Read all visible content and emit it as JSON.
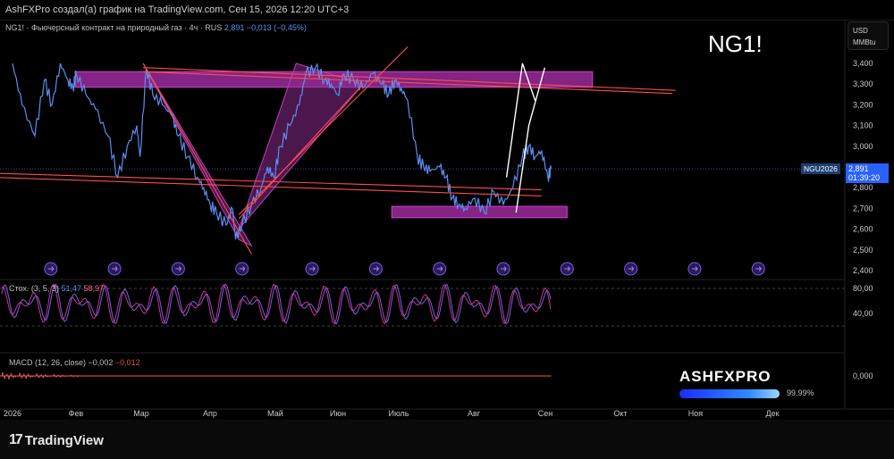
{
  "header": {
    "text": "AshFXPro создал(а) график на TradingView.com, Сен 15, 2026 12:20 UTC+3"
  },
  "legend": {
    "main_label": "NG1! · Фьючерсный контракт на природный газ · 4ч · RUS",
    "main_price": "2,891",
    "main_change": "−0,013 (−0,45%)",
    "stoch_label": "Стох. (3, 5, 3)",
    "stoch_k": "51,47",
    "stoch_d": "58,97",
    "macd_label": "MACD (12, 26, close)",
    "macd_val1": "−0,002",
    "macd_val2": "−0,012"
  },
  "title_overlay": "NG1!",
  "currency": {
    "line1": "USD",
    "line2": "MMBtu"
  },
  "price_tag": {
    "symbol": "NGU2026",
    "price": "2,891",
    "countdown": "01:39:20"
  },
  "brand": {
    "name": "ASHFXPRO",
    "percent": "99.99%"
  },
  "footer": {
    "logo_text": "TradingView",
    "logo_mark": "17"
  },
  "colors": {
    "background": "#000000",
    "price_line": "#5b8ff0",
    "zone_fill": "#b030b0",
    "trendline": "#ff4d4d",
    "stoch_k": "#6a6ad8",
    "stoch_d": "#d0309a",
    "macd_hist": "#e35b5b"
  },
  "chart_data": [
    {
      "type": "line",
      "pane": "price",
      "title": "NG1!",
      "x_labels": [
        "2026",
        "Фев",
        "Мар",
        "Апр",
        "Май",
        "Июн",
        "Июль",
        "Авг",
        "Сен",
        "Окт",
        "Ноя",
        "Дек"
      ],
      "y_ticks": [
        "3,400",
        "3,300",
        "3,200",
        "3,100",
        "3,000",
        "2,900",
        "2,800",
        "2,700",
        "2,600",
        "2,500",
        "2,400"
      ],
      "ylim": [
        2.4,
        3.4
      ],
      "x_month_index": [
        0.0,
        0.15,
        0.35,
        0.5,
        0.62,
        0.75,
        0.87,
        0.95,
        1.0,
        1.15,
        1.3,
        1.5,
        1.65,
        1.8,
        1.95,
        2.0,
        2.1,
        2.2,
        2.35,
        2.5,
        2.6,
        2.75,
        2.9,
        3.0,
        3.1,
        3.2,
        3.35,
        3.45,
        3.5,
        3.6,
        3.75,
        3.9,
        4.0,
        4.1,
        4.2,
        4.35,
        4.5,
        4.6,
        4.75,
        4.9,
        5.0,
        5.1,
        5.2,
        5.35,
        5.5,
        5.65,
        5.8,
        5.9,
        6.0,
        6.1,
        6.2,
        6.35,
        6.45,
        6.55,
        6.7,
        6.8,
        6.9,
        7.0,
        7.1,
        7.25,
        7.4,
        7.55,
        7.7,
        7.85,
        8.0,
        8.1,
        8.2,
        8.3,
        8.4,
        8.45
      ],
      "values": [
        3.4,
        3.2,
        3.05,
        3.32,
        3.2,
        3.4,
        3.32,
        3.28,
        3.35,
        3.25,
        3.18,
        3.05,
        2.85,
        3.0,
        3.1,
        2.95,
        3.38,
        3.25,
        3.2,
        3.15,
        3.05,
        2.95,
        2.85,
        2.8,
        2.72,
        2.68,
        2.62,
        2.7,
        2.55,
        2.62,
        2.72,
        2.8,
        2.9,
        2.85,
        3.0,
        3.1,
        3.2,
        3.35,
        3.38,
        3.32,
        3.3,
        3.25,
        3.35,
        3.32,
        3.28,
        3.35,
        3.3,
        3.25,
        3.32,
        3.28,
        3.22,
        2.95,
        2.9,
        2.88,
        2.9,
        2.85,
        2.75,
        2.72,
        2.7,
        2.75,
        2.68,
        2.78,
        2.72,
        2.8,
        2.95,
        3.0,
        2.95,
        2.98,
        2.85,
        2.89
      ],
      "zones": [
        {
          "x0": 0.0,
          "x1": 9.1,
          "y0": 3.285,
          "y1": 3.36
        },
        {
          "x0": 5.95,
          "x1": 8.7,
          "y0": 2.655,
          "y1": 2.71
        }
      ],
      "trendlines": [
        {
          "x": [
            2.05,
            10.4
          ],
          "y": [
            3.38,
            3.27
          ]
        },
        {
          "x": [
            2.05,
            10.35
          ],
          "y": [
            3.36,
            3.255
          ]
        },
        {
          "x": [
            -0.3,
            8.3
          ],
          "y": [
            2.87,
            2.79
          ]
        },
        {
          "x": [
            -0.3,
            8.3
          ],
          "y": [
            2.85,
            2.76
          ]
        },
        {
          "x": [
            3.55,
            5.5
          ],
          "y": [
            2.65,
            3.3
          ]
        },
        {
          "x": [
            3.55,
            6.2
          ],
          "y": [
            2.67,
            3.48
          ]
        },
        {
          "x": [
            2.05,
            3.75
          ],
          "y": [
            3.4,
            2.48
          ]
        }
      ],
      "triangles": [
        {
          "x": [
            2.05,
            3.55,
            3.75
          ],
          "y": [
            3.4,
            2.55,
            2.52
          ]
        },
        {
          "x": [
            3.55,
            4.45,
            5.5
          ],
          "y": [
            2.6,
            3.4,
            3.3
          ]
        }
      ],
      "arrows": [
        {
          "x": [
            7.75,
            8.0,
            8.2
          ],
          "y": [
            2.85,
            3.4,
            3.22
          ]
        },
        {
          "x": [
            7.9,
            8.1,
            8.35
          ],
          "y": [
            2.68,
            3.1,
            3.38
          ]
        }
      ],
      "event_markers_month_index": [
        0.6,
        1.6,
        2.6,
        3.6,
        4.7,
        5.7,
        6.7,
        7.7,
        8.7,
        9.7,
        10.7,
        11.7
      ],
      "last_price": 2.891
    },
    {
      "type": "line",
      "pane": "oscillator",
      "title": "Стох. (3, 5, 3)",
      "y_ticks": [
        "80,00",
        "40,00"
      ],
      "ylim": [
        0,
        100
      ],
      "levels": [
        80,
        20
      ],
      "series": [
        {
          "name": "51,47",
          "pattern": "oscillating",
          "period_months": 0.35,
          "low": 25,
          "high": 90,
          "last": 51.47
        },
        {
          "name": "58,97",
          "pattern": "oscillating",
          "period_months": 0.35,
          "low": 25,
          "high": 90,
          "last": 58.97
        }
      ]
    },
    {
      "type": "bar",
      "pane": "macd",
      "title": "MACD (12, 26, close)",
      "y_ticks": [
        "0,000"
      ],
      "ylim": [
        -0.1,
        0.1
      ],
      "values_at_start": [
        0.05,
        -0.04,
        0.03,
        -0.05,
        0.04,
        -0.03,
        -0.02,
        -0.01
      ],
      "last": [
        -0.002,
        -0.012
      ]
    }
  ]
}
